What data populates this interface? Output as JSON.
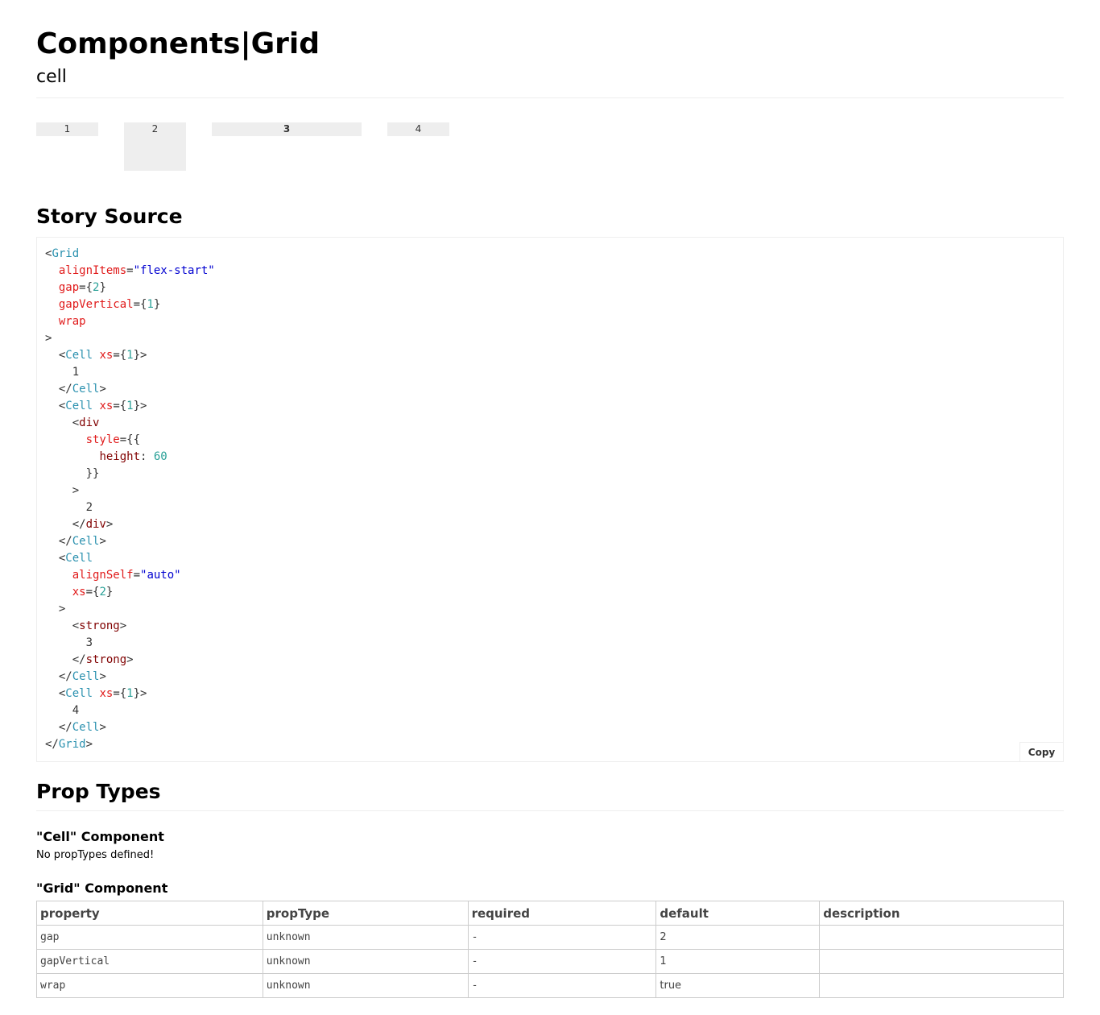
{
  "header": {
    "title": "Components|Grid",
    "subtitle": "cell"
  },
  "preview": {
    "cells": [
      "1",
      "2",
      "3",
      "4"
    ]
  },
  "story_source": {
    "heading": "Story Source",
    "copy_label": "Copy",
    "lines": [
      [
        [
          "p",
          "<"
        ],
        [
          "tag",
          "Grid"
        ]
      ],
      [
        [
          "p",
          "  "
        ],
        [
          "attr",
          "alignItems"
        ],
        [
          "p",
          "="
        ],
        [
          "str",
          "\"flex-start\""
        ]
      ],
      [
        [
          "p",
          "  "
        ],
        [
          "attr",
          "gap"
        ],
        [
          "p",
          "={"
        ],
        [
          "num",
          "2"
        ],
        [
          "p",
          "}"
        ]
      ],
      [
        [
          "p",
          "  "
        ],
        [
          "attr",
          "gapVertical"
        ],
        [
          "p",
          "={"
        ],
        [
          "num",
          "1"
        ],
        [
          "p",
          "}"
        ]
      ],
      [
        [
          "p",
          "  "
        ],
        [
          "attr",
          "wrap"
        ]
      ],
      [
        [
          "p",
          ">"
        ]
      ],
      [
        [
          "p",
          "  <"
        ],
        [
          "tag",
          "Cell"
        ],
        [
          "p",
          " "
        ],
        [
          "attr",
          "xs"
        ],
        [
          "p",
          "={"
        ],
        [
          "num",
          "1"
        ],
        [
          "p",
          "}>"
        ]
      ],
      [
        [
          "p",
          "    1"
        ]
      ],
      [
        [
          "p",
          "  </"
        ],
        [
          "tag",
          "Cell"
        ],
        [
          "p",
          ">"
        ]
      ],
      [
        [
          "p",
          "  <"
        ],
        [
          "tag",
          "Cell"
        ],
        [
          "p",
          " "
        ],
        [
          "attr",
          "xs"
        ],
        [
          "p",
          "={"
        ],
        [
          "num",
          "1"
        ],
        [
          "p",
          "}>"
        ]
      ],
      [
        [
          "p",
          "    <"
        ],
        [
          "el",
          "div"
        ]
      ],
      [
        [
          "p",
          "      "
        ],
        [
          "attr",
          "style"
        ],
        [
          "p",
          "={{"
        ]
      ],
      [
        [
          "p",
          "        "
        ],
        [
          "el",
          "height"
        ],
        [
          "p",
          ": "
        ],
        [
          "num",
          "60"
        ]
      ],
      [
        [
          "p",
          "      }}"
        ]
      ],
      [
        [
          "p",
          "    >"
        ]
      ],
      [
        [
          "p",
          "      2"
        ]
      ],
      [
        [
          "p",
          "    </"
        ],
        [
          "el",
          "div"
        ],
        [
          "p",
          ">"
        ]
      ],
      [
        [
          "p",
          "  </"
        ],
        [
          "tag",
          "Cell"
        ],
        [
          "p",
          ">"
        ]
      ],
      [
        [
          "p",
          "  <"
        ],
        [
          "tag",
          "Cell"
        ]
      ],
      [
        [
          "p",
          "    "
        ],
        [
          "attr",
          "alignSelf"
        ],
        [
          "p",
          "="
        ],
        [
          "str",
          "\"auto\""
        ]
      ],
      [
        [
          "p",
          "    "
        ],
        [
          "attr",
          "xs"
        ],
        [
          "p",
          "={"
        ],
        [
          "num",
          "2"
        ],
        [
          "p",
          "}"
        ]
      ],
      [
        [
          "p",
          "  >"
        ]
      ],
      [
        [
          "p",
          "    <"
        ],
        [
          "el",
          "strong"
        ],
        [
          "p",
          ">"
        ]
      ],
      [
        [
          "p",
          "      3"
        ]
      ],
      [
        [
          "p",
          "    </"
        ],
        [
          "el",
          "strong"
        ],
        [
          "p",
          ">"
        ]
      ],
      [
        [
          "p",
          "  </"
        ],
        [
          "tag",
          "Cell"
        ],
        [
          "p",
          ">"
        ]
      ],
      [
        [
          "p",
          "  <"
        ],
        [
          "tag",
          "Cell"
        ],
        [
          "p",
          " "
        ],
        [
          "attr",
          "xs"
        ],
        [
          "p",
          "={"
        ],
        [
          "num",
          "1"
        ],
        [
          "p",
          "}>"
        ]
      ],
      [
        [
          "p",
          "    4"
        ]
      ],
      [
        [
          "p",
          "  </"
        ],
        [
          "tag",
          "Cell"
        ],
        [
          "p",
          ">"
        ]
      ],
      [
        [
          "p",
          "</"
        ],
        [
          "tag",
          "Grid"
        ],
        [
          "p",
          ">"
        ]
      ]
    ]
  },
  "prop_types": {
    "heading": "Prop Types",
    "cell_component": {
      "title": "\"Cell\" Component",
      "empty_text": "No propTypes defined!"
    },
    "grid_component": {
      "title": "\"Grid\" Component",
      "columns": [
        "property",
        "propType",
        "required",
        "default",
        "description"
      ],
      "rows": [
        {
          "property": "gap",
          "propType": "unknown",
          "required": "-",
          "default": "2",
          "description": ""
        },
        {
          "property": "gapVertical",
          "propType": "unknown",
          "required": "-",
          "default": "1",
          "description": ""
        },
        {
          "property": "wrap",
          "propType": "unknown",
          "required": "-",
          "default": "true",
          "description": ""
        }
      ]
    }
  }
}
